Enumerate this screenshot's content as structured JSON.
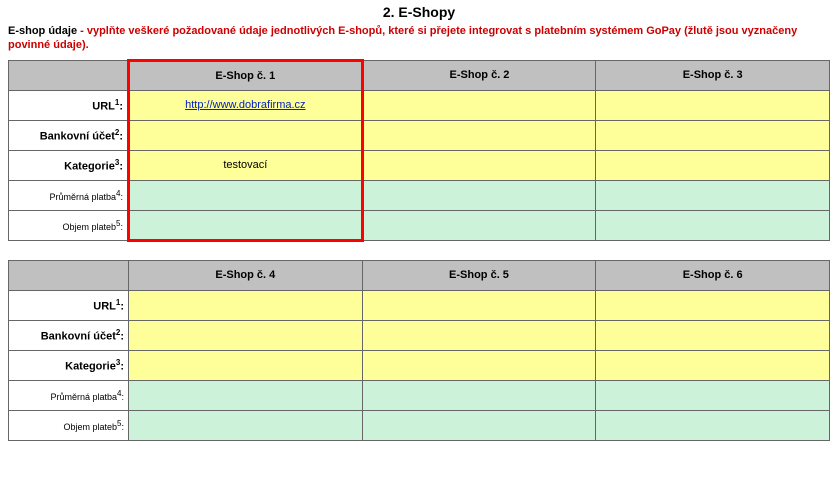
{
  "heading": "2. E-Shopy",
  "intro": {
    "label": "E-shop údaje",
    "text": " - vyplňte veškeré požadované údaje jednotlivých E-shopů, které si přejete integrovat s platebním systémem GoPay (žlutě jsou vyznačeny povinné údaje)."
  },
  "row_labels": {
    "url": "URL",
    "url_sup": "1",
    "bank": "Bankovní účet",
    "bank_sup": "2",
    "kategorie": "Kategorie",
    "kategorie_sup": "3",
    "prumerna": "Průměrná platba",
    "prumerna_sup": "4",
    "objem": "Objem plateb",
    "objem_sup": "5",
    "colon": ":"
  },
  "table1": {
    "headers": [
      "E-Shop č. 1",
      "E-Shop č. 2",
      "E-Shop č. 3"
    ],
    "shops": [
      {
        "url": "http://www.dobrafirma.cz",
        "bank": "",
        "kategorie": "testovací",
        "prumerna": "",
        "objem": ""
      },
      {
        "url": "",
        "bank": "",
        "kategorie": "",
        "prumerna": "",
        "objem": ""
      },
      {
        "url": "",
        "bank": "",
        "kategorie": "",
        "prumerna": "",
        "objem": ""
      }
    ]
  },
  "table2": {
    "headers": [
      "E-Shop č. 4",
      "E-Shop č. 5",
      "E-Shop č. 6"
    ],
    "shops": [
      {
        "url": "",
        "bank": "",
        "kategorie": "",
        "prumerna": "",
        "objem": ""
      },
      {
        "url": "",
        "bank": "",
        "kategorie": "",
        "prumerna": "",
        "objem": ""
      },
      {
        "url": "",
        "bank": "",
        "kategorie": "",
        "prumerna": "",
        "objem": ""
      }
    ]
  }
}
